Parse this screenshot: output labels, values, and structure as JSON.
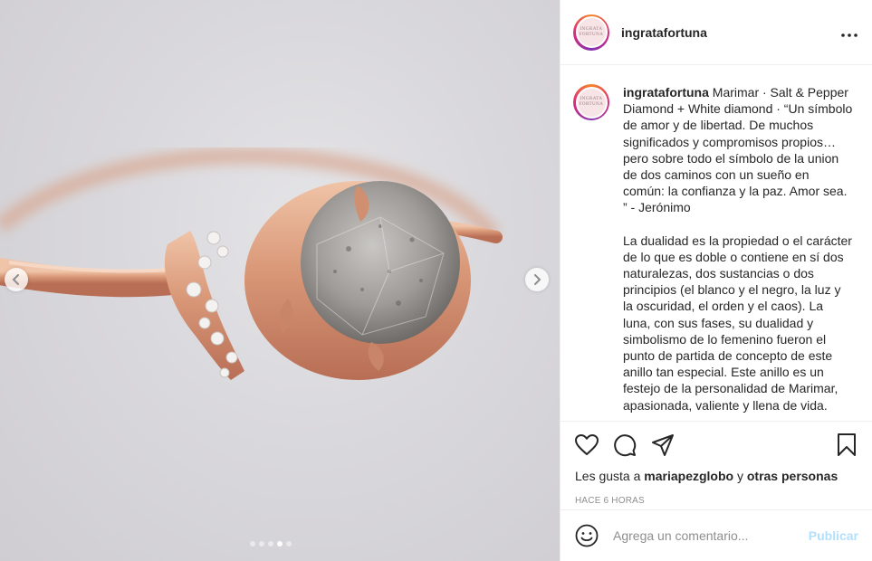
{
  "post": {
    "username": "ingratafortuna",
    "avatar_text_top": "INGRATA",
    "avatar_text_bottom": "FORTUNA",
    "more_icon": "more-horizontal-icon"
  },
  "carousel": {
    "prev_icon": "chevron-left-icon",
    "next_icon": "chevron-right-icon",
    "total_slides": 5,
    "current_slide": 4
  },
  "caption": {
    "username": "ingratafortuna",
    "paragraph1": "Marimar · Salt & Pepper Diamond + White diamond · “Un símbolo de amor y de libertad. De muchos significados y compromisos propios… pero sobre todo el símbolo de la union de dos caminos con un sueño en común: la confianza y la paz. Amor sea. ” - Jerónimo",
    "paragraph2": "La dualidad es la propiedad o el carácter de lo que es doble o contiene en sí dos naturalezas, dos sustancias o dos principios (el blanco y el negro, la luz y la oscuridad, el orden y el caos). La luna, con sus fases, su dualidad y simbolismo de lo femenino fueron el punto de partida de concepto de este anillo tan especial. Este anillo es un festejo de la personalidad de Marimar, apasionada, valiente y llena de vida."
  },
  "likes": {
    "prefix": "Les gusta a",
    "user": "mariapezglobo",
    "connector": "y",
    "others": "otras personas"
  },
  "timestamp": "HACE 6 HORAS",
  "comment": {
    "placeholder": "Agrega un comentario...",
    "publish_label": "Publicar"
  },
  "colors": {
    "publish_disabled": "#b2dffc",
    "border": "#efefef",
    "secondary_text": "#8e8e8e",
    "primary_text": "#262626"
  }
}
